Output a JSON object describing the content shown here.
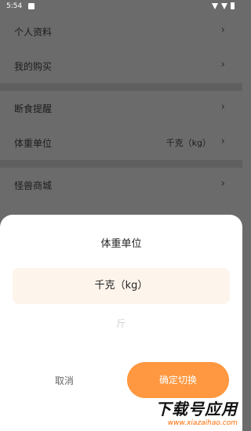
{
  "status_bar": {
    "time": "5:54"
  },
  "settings": [
    {
      "label": "个人资料",
      "value": ""
    },
    {
      "label": "我的购买",
      "value": ""
    },
    {
      "label": "断食提醒",
      "value": ""
    },
    {
      "label": "体重单位",
      "value": "千克（kg）"
    },
    {
      "label": "怪兽商城",
      "value": ""
    }
  ],
  "chevron_glyph": "›",
  "sheet": {
    "title": "体重单位",
    "options": [
      "千克（kg）",
      "斤"
    ],
    "cancel_label": "取消",
    "confirm_label": "确定切换"
  },
  "watermark": {
    "title": "下载号应用",
    "url": "www.xiazaihao.com"
  },
  "colors": {
    "accent": "#ff9840",
    "selected_bg": "#fdf4ec",
    "overlay": "#6b6b6b"
  }
}
